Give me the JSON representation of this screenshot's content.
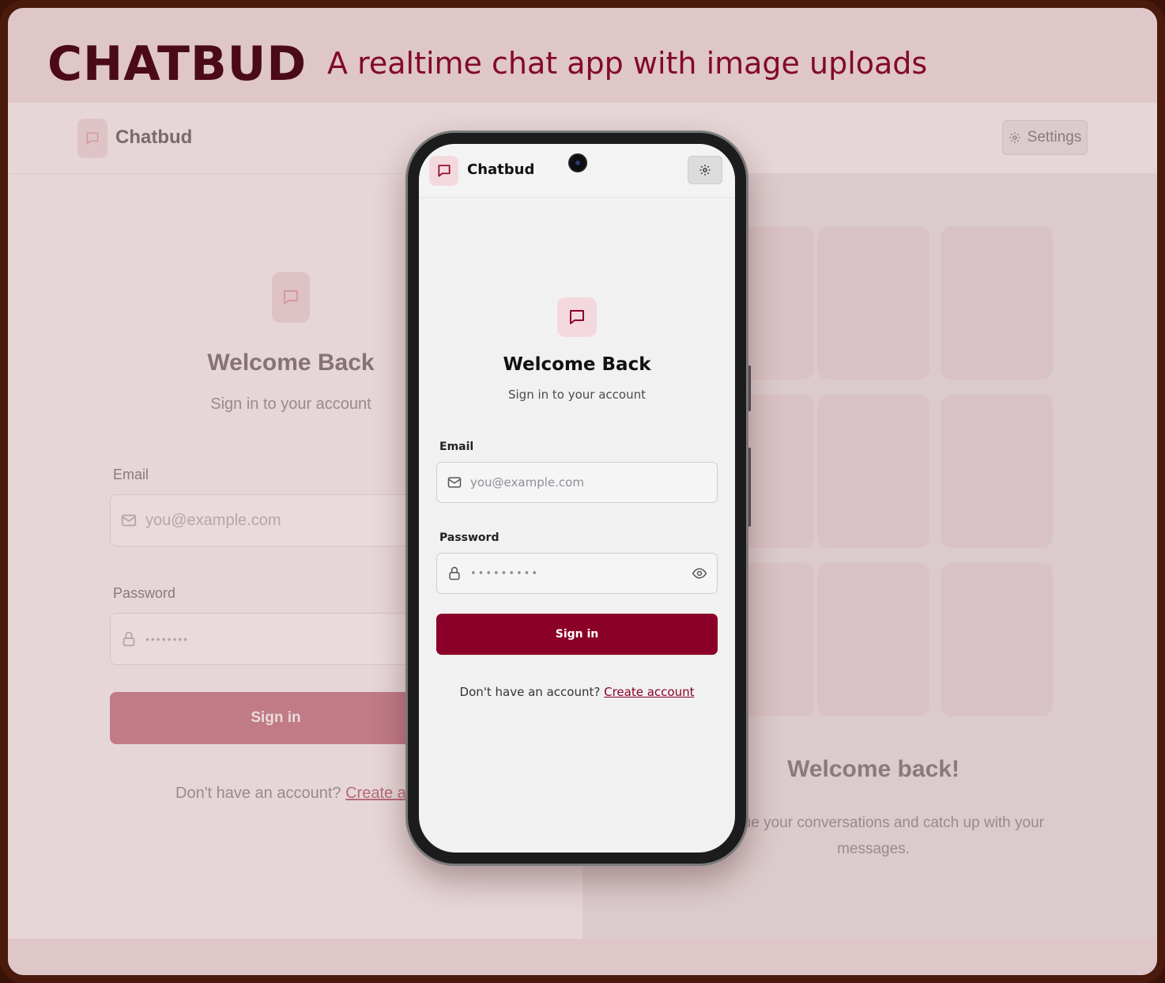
{
  "banner": {
    "brand": "CHATBUD",
    "tagline": "A realtime chat app with image uploads"
  },
  "desktop": {
    "app_name": "Chatbud",
    "settings_label": "Settings",
    "title": "Welcome Back",
    "subtitle": "Sign in to your account",
    "email_label": "Email",
    "email_placeholder": "you@example.com",
    "password_label": "Password",
    "password_mask": "••••••••",
    "signin_label": "Sign in",
    "footer_text": "Don't have an account?",
    "footer_link": "Create account",
    "right_title": "Welcome back!",
    "right_desc": "continue your conversations and catch up with your messages."
  },
  "phone": {
    "app_name": "Chatbud",
    "title": "Welcome Back",
    "subtitle": "Sign in to your account",
    "email_label": "Email",
    "email_placeholder": "you@example.com",
    "password_label": "Password",
    "password_mask": "•••••••••",
    "signin_label": "Sign in",
    "footer_text": "Don't have an account?",
    "footer_link": "Create account"
  },
  "colors": {
    "brand_dark": "#4a0a18",
    "accent": "#8b0028",
    "frame": "#4a1a0c"
  },
  "icons": [
    "message-square-icon",
    "gear-icon",
    "mail-icon",
    "lock-icon",
    "eye-icon"
  ]
}
